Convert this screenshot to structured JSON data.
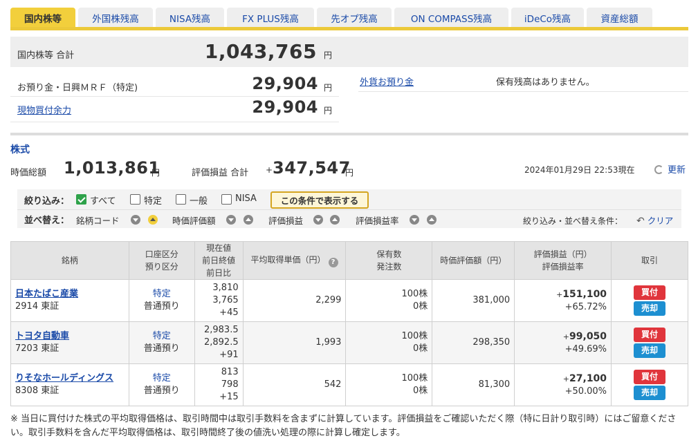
{
  "tabs": [
    {
      "label": "国内株等",
      "active": true
    },
    {
      "label": "外国株残高"
    },
    {
      "label": "NISA残高"
    },
    {
      "label": "FX PLUS残高"
    },
    {
      "label": "先オプ残高"
    },
    {
      "label": "ON COMPASS残高"
    },
    {
      "label": "iDeCo残高"
    },
    {
      "label": "資産総額"
    }
  ],
  "summary": {
    "total_label": "国内株等 合計",
    "total_value": "1,043,765",
    "yen": "円",
    "mrf_label": "お預り金・日興ＭＲＦ（特定)",
    "mrf_value": "29,904",
    "buying_power_label": "現物買付余力",
    "buying_power_value": "29,904",
    "fx_label": "外貨お預り金",
    "fx_value": "保有残高はありません。"
  },
  "stocks": {
    "title": "株式",
    "market_value_label": "時価総額",
    "market_value": "1,013,861",
    "pl_total_label": "評価損益 合計",
    "pl_total_sign": "+",
    "pl_total_value": "347,547",
    "timestamp": "2024年01月29日 22:53現在",
    "refresh_label": "更新"
  },
  "filter": {
    "label": "絞り込み：",
    "options": [
      "すべて",
      "特定",
      "一般",
      "NISA"
    ],
    "apply_label": "この条件で表示する",
    "sort_label": "並べ替え：",
    "sort_fields": [
      "銘柄コード",
      "時価評価額",
      "評価損益",
      "評価損益率"
    ],
    "condition_label": "絞り込み・並べ替え条件：",
    "clear_label": "クリア"
  },
  "table": {
    "headers": {
      "name": "銘柄",
      "account1": "口座区分",
      "account2": "預り区分",
      "price1": "現在値",
      "price2": "前日終値",
      "price3": "前日比",
      "avg_cost": "平均取得単価（円）",
      "qty1": "保有数",
      "qty2": "発注数",
      "market_value": "時価評価額（円）",
      "pl1": "評価損益（円）",
      "pl2": "評価損益率",
      "trade": "取引"
    },
    "rows": [
      {
        "name": "日本たばこ産業",
        "code": "2914 東証",
        "account": "特定",
        "deposit": "普通預り",
        "price": "3,810",
        "prev_close": "3,765",
        "change": "+45",
        "avg_cost": "2,299",
        "qty": "100株",
        "orders": "0株",
        "market_value": "381,000",
        "pl_sign": "+",
        "pl": "151,100",
        "pl_rate": "+65.72%"
      },
      {
        "name": "トヨタ自動車",
        "code": "7203 東証",
        "account": "特定",
        "deposit": "普通預り",
        "price": "2,983.5",
        "prev_close": "2,892.5",
        "change": "+91",
        "avg_cost": "1,993",
        "qty": "100株",
        "orders": "0株",
        "market_value": "298,350",
        "pl_sign": "+",
        "pl": "99,050",
        "pl_rate": "+49.69%"
      },
      {
        "name": "りそなホールディングス",
        "code": "8308 東証",
        "account": "特定",
        "deposit": "普通預り",
        "price": "813",
        "prev_close": "798",
        "change": "+15",
        "avg_cost": "542",
        "qty": "100株",
        "orders": "0株",
        "market_value": "81,300",
        "pl_sign": "+",
        "pl": "27,100",
        "pl_rate": "+50.00%"
      }
    ],
    "buy_label": "買付",
    "sell_label": "売却"
  },
  "note": "※ 当日に買付けた株式の平均取得価格は、取引時間中は取引手数料を含まずに計算しています。評価損益をご確認いただく際（特に日計り取引時）にはご留意ください。取引手数料を含んだ平均取得価格は、取引時間終了後の値洗い処理の際に計算し確定します。",
  "colors": {
    "accent": "#f2cf3c",
    "link": "#1a4aa8",
    "buy": "#e0353c",
    "sell": "#1d8fd1"
  }
}
